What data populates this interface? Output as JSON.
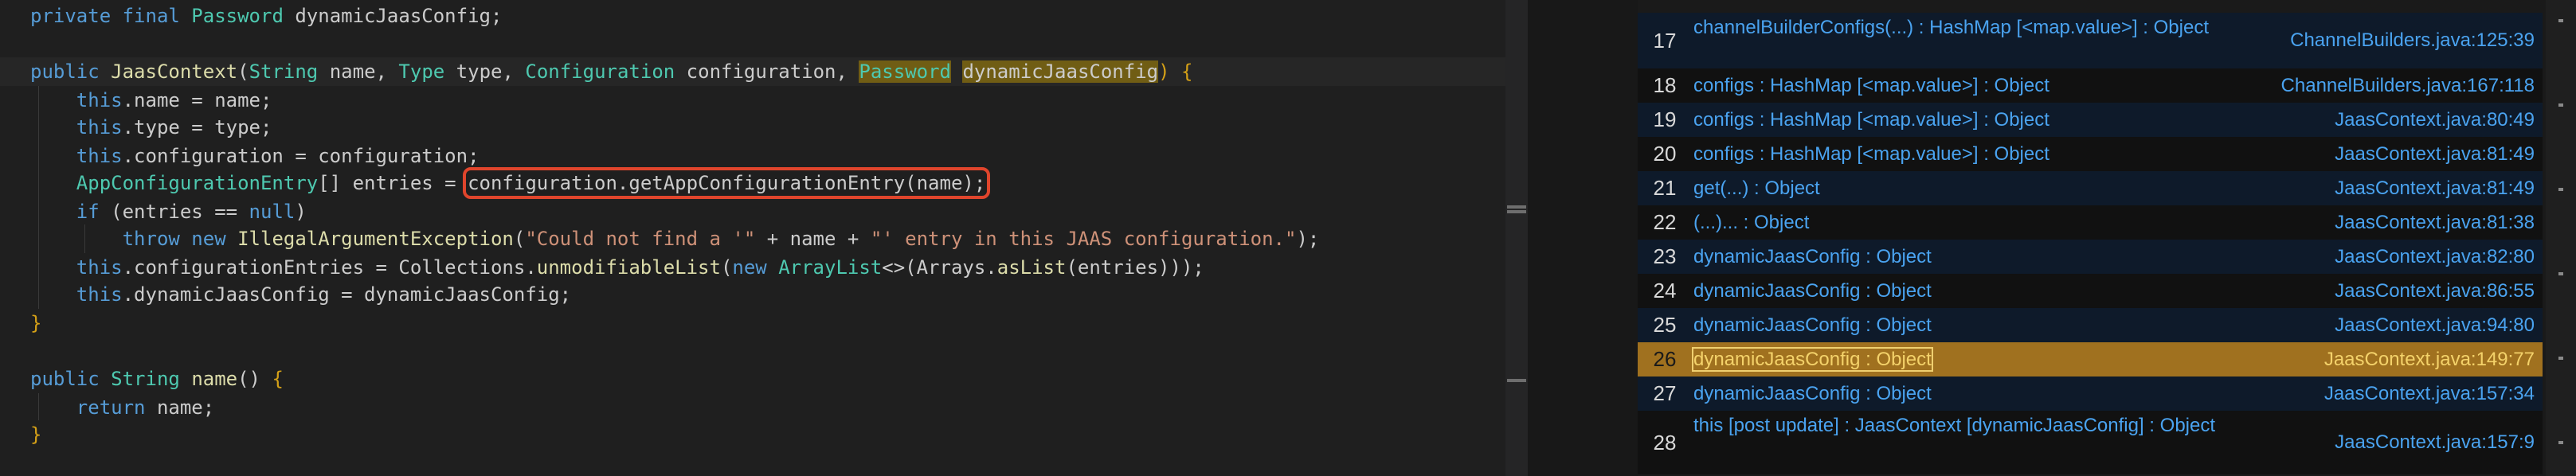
{
  "editor": {
    "lines": [
      {
        "id": "field-decl",
        "tokens": [
          [
            "kw",
            "private final "
          ],
          [
            "ty",
            "Password"
          ],
          [
            "pl",
            " dynamicJaasConfig;"
          ]
        ]
      },
      {
        "id": "blank-1",
        "tokens": []
      },
      {
        "id": "ctor-sig",
        "tokens": [
          [
            "kw",
            "public "
          ],
          [
            "fn",
            "JaasContext"
          ],
          [
            "pl",
            "("
          ],
          [
            "ty",
            "String"
          ],
          [
            "pl",
            " name, "
          ],
          [
            "ty",
            "Type"
          ],
          [
            "pl",
            " type, "
          ],
          [
            "ty",
            "Configuration"
          ],
          [
            "pl",
            " configuration, "
          ],
          [
            "hl-pw",
            "Password"
          ],
          [
            "pl",
            " "
          ],
          [
            "hl-var",
            "dynamicJaasConfig"
          ],
          [
            "brace",
            ")"
          ],
          [
            "pl",
            " "
          ],
          [
            "brace",
            "{"
          ]
        ]
      },
      {
        "id": "assign-name",
        "tokens": [
          [
            "pl",
            "    "
          ],
          [
            "kw",
            "this"
          ],
          [
            "pl",
            ".name = name;"
          ]
        ]
      },
      {
        "id": "assign-type",
        "tokens": [
          [
            "pl",
            "    "
          ],
          [
            "kw",
            "this"
          ],
          [
            "pl",
            ".type = type;"
          ]
        ]
      },
      {
        "id": "assign-config",
        "tokens": [
          [
            "pl",
            "    "
          ],
          [
            "kw",
            "this"
          ],
          [
            "pl",
            ".configuration = configuration;"
          ]
        ]
      },
      {
        "id": "entries-decl",
        "tokens": [
          [
            "pl",
            "    "
          ],
          [
            "ty",
            "AppConfigurationEntry"
          ],
          [
            "pl",
            "[] entries = "
          ],
          [
            "boxed",
            "configuration.getAppConfigurationEntry(name);"
          ]
        ]
      },
      {
        "id": "if-null",
        "tokens": [
          [
            "pl",
            "    "
          ],
          [
            "kw",
            "if"
          ],
          [
            "pl",
            " (entries == "
          ],
          [
            "kw",
            "null"
          ],
          [
            "pl",
            ")"
          ]
        ]
      },
      {
        "id": "throw",
        "tokens": [
          [
            "pl",
            "        "
          ],
          [
            "kw",
            "throw new "
          ],
          [
            "fn",
            "IllegalArgumentException"
          ],
          [
            "pl",
            "("
          ],
          [
            "str",
            "\"Could not find a '\""
          ],
          [
            "pl",
            " + name + "
          ],
          [
            "str",
            "\"' entry in this JAAS configuration.\""
          ],
          [
            "pl",
            ");"
          ]
        ]
      },
      {
        "id": "config-entries",
        "tokens": [
          [
            "pl",
            "    "
          ],
          [
            "kw",
            "this"
          ],
          [
            "pl",
            ".configurationEntries = Collections."
          ],
          [
            "fn",
            "unmodifiableList"
          ],
          [
            "pl",
            "("
          ],
          [
            "kw",
            "new "
          ],
          [
            "ty",
            "ArrayList"
          ],
          [
            "pl",
            "<>(Arrays."
          ],
          [
            "fn",
            "asList"
          ],
          [
            "pl",
            "(entries)));"
          ]
        ]
      },
      {
        "id": "assign-dynamic",
        "tokens": [
          [
            "pl",
            "    "
          ],
          [
            "kw",
            "this"
          ],
          [
            "pl",
            ".dynamicJaasConfig = dynamicJaasConfig;"
          ]
        ]
      },
      {
        "id": "close-ctor",
        "tokens": [
          [
            "brace",
            "}"
          ]
        ]
      },
      {
        "id": "blank-2",
        "tokens": []
      },
      {
        "id": "name-sig",
        "tokens": [
          [
            "kw",
            "public "
          ],
          [
            "ty",
            "String"
          ],
          [
            "pl",
            " "
          ],
          [
            "fn",
            "name"
          ],
          [
            "pl",
            "() "
          ],
          [
            "brace",
            "{"
          ]
        ]
      },
      {
        "id": "return-name",
        "tokens": [
          [
            "pl",
            "    "
          ],
          [
            "kw",
            "return"
          ],
          [
            "pl",
            " name;"
          ]
        ]
      },
      {
        "id": "close-name",
        "tokens": [
          [
            "brace",
            "}"
          ]
        ]
      }
    ]
  },
  "dataflow": {
    "rows": [
      {
        "num": "17",
        "label": "channelBuilderConfigs(...) : HashMap [<map.value>] : Object",
        "loc": "ChannelBuilders.java:125:39",
        "selected": false
      },
      {
        "num": "18",
        "label": "configs : HashMap [<map.value>] : Object",
        "loc": "ChannelBuilders.java:167:118",
        "selected": false
      },
      {
        "num": "19",
        "label": "configs : HashMap [<map.value>] : Object",
        "loc": "JaasContext.java:80:49",
        "selected": false
      },
      {
        "num": "20",
        "label": "configs : HashMap [<map.value>] : Object",
        "loc": "JaasContext.java:81:49",
        "selected": false
      },
      {
        "num": "21",
        "label": "get(...) : Object",
        "loc": "JaasContext.java:81:49",
        "selected": false
      },
      {
        "num": "22",
        "label": "(...)... : Object",
        "loc": "JaasContext.java:81:38",
        "selected": false
      },
      {
        "num": "23",
        "label": "dynamicJaasConfig : Object",
        "loc": "JaasContext.java:82:80",
        "selected": false
      },
      {
        "num": "24",
        "label": "dynamicJaasConfig : Object",
        "loc": "JaasContext.java:86:55",
        "selected": false
      },
      {
        "num": "25",
        "label": "dynamicJaasConfig : Object",
        "loc": "JaasContext.java:94:80",
        "selected": false
      },
      {
        "num": "26",
        "label": "dynamicJaasConfig : Object",
        "loc": "JaasContext.java:149:77",
        "selected": true
      },
      {
        "num": "27",
        "label": "dynamicJaasConfig : Object",
        "loc": "JaasContext.java:157:34",
        "selected": false
      },
      {
        "num": "28",
        "label": "this [post update] : JaasContext [dynamicJaasConfig] : Object",
        "loc": "JaasContext.java:157:9",
        "selected": false
      }
    ]
  },
  "colors": {
    "selected_row": "#a0711f",
    "highlight_box": "#e0452c",
    "link": "#4aa3f0"
  }
}
